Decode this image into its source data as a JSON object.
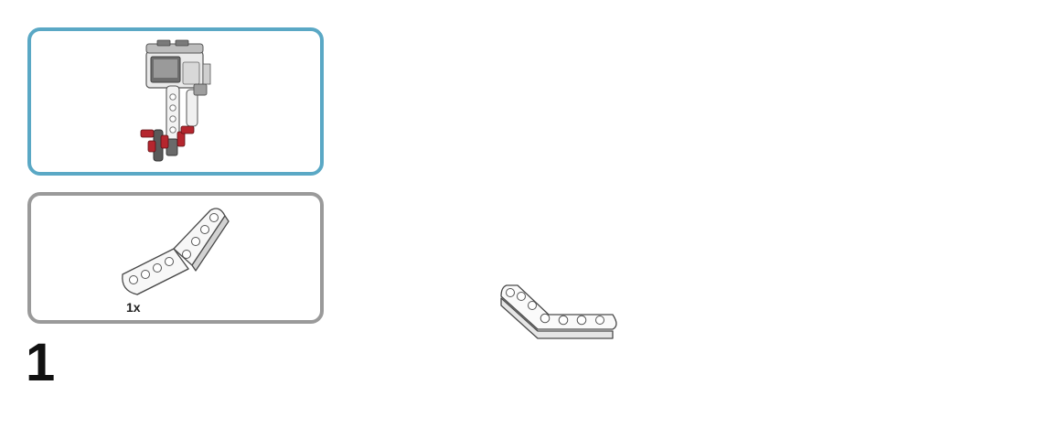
{
  "step": {
    "number": "1"
  },
  "model_preview": {
    "icon": "partial-model-icon"
  },
  "parts_list": {
    "items": [
      {
        "icon": "angled-beam-icon",
        "quantity": "1x"
      }
    ]
  },
  "assembly": {
    "icon": "angled-beam-icon"
  },
  "colors": {
    "model_panel_border": "#5aa8c5",
    "parts_panel_border": "#9a9a9a",
    "part_red": "#b5262e"
  }
}
